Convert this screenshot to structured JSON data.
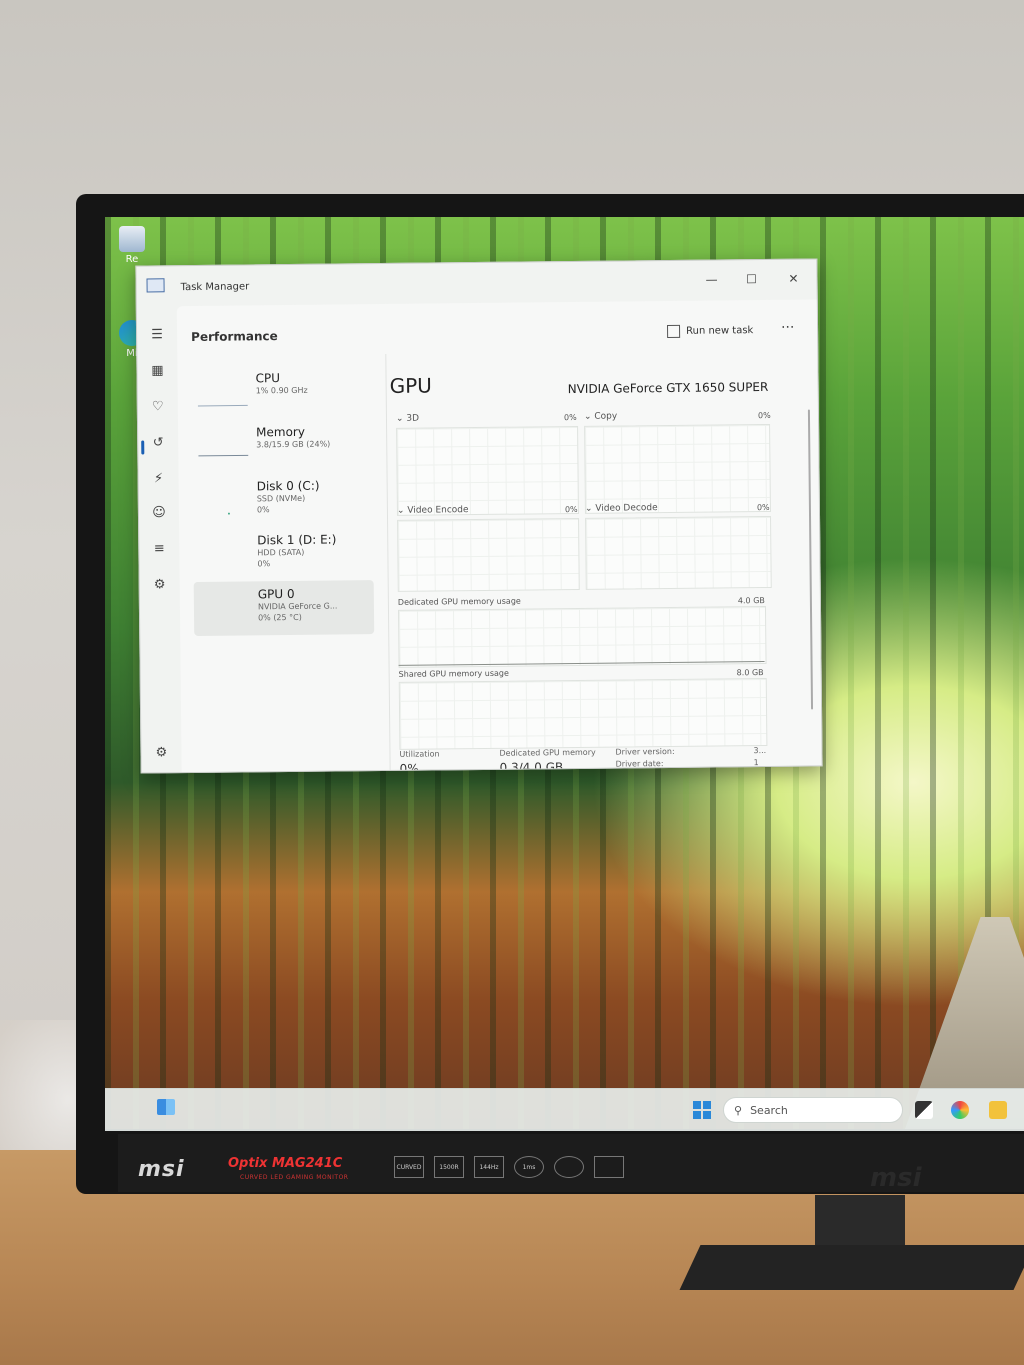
{
  "desktop": {
    "icons": [
      {
        "label": "Re",
        "icon": "recycle-bin-icon"
      },
      {
        "label": "Mi",
        "icon": "edge-icon"
      }
    ]
  },
  "monitor": {
    "brand": "msi",
    "model": "Optix MAG241C",
    "model_sub": "CURVED LED GAMING MONITOR",
    "features": [
      "CURVED",
      "1500R",
      "144Hz",
      "1ms",
      "",
      ""
    ],
    "brand_right": "msi"
  },
  "task_manager": {
    "window_title": "Task Manager",
    "page_title": "Performance",
    "run_new_task": "Run new task",
    "more_label": "···",
    "window_controls": {
      "minimize": "—",
      "maximize": "☐",
      "close": "✕"
    },
    "nav_icons": [
      "hamburger-icon",
      "processes-icon",
      "performance-icon",
      "app-history-icon",
      "startup-apps-icon",
      "users-icon",
      "details-icon",
      "services-icon",
      "settings-icon"
    ],
    "resources": [
      {
        "name": "CPU",
        "line1": "1% 0.90 GHz",
        "line2": ""
      },
      {
        "name": "Memory",
        "line1": "3.8/15.9 GB (24%)",
        "line2": ""
      },
      {
        "name": "Disk 0 (C:)",
        "line1": "SSD (NVMe)",
        "line2": "0%"
      },
      {
        "name": "Disk 1 (D: E:)",
        "line1": "HDD (SATA)",
        "line2": "0%"
      },
      {
        "name": "GPU 0",
        "line1": "NVIDIA GeForce G...",
        "line2": "0% (25 °C)"
      }
    ],
    "selected_resource": "GPU 0",
    "detail": {
      "heading": "GPU",
      "model": "NVIDIA GeForce GTX 1650 SUPER",
      "engines": [
        {
          "label": "3D",
          "pct": "0%"
        },
        {
          "label": "Copy",
          "pct": "0%"
        },
        {
          "label": "Video Encode",
          "pct": "0%"
        },
        {
          "label": "Video Decode",
          "pct": "0%"
        }
      ],
      "dedicated_label": "Dedicated GPU memory usage",
      "dedicated_max": "4.0 GB",
      "shared_label": "Shared GPU memory usage",
      "shared_max": "8.0 GB",
      "stats": [
        {
          "label": "Utilization",
          "value": "0%"
        },
        {
          "label": "Dedicated GPU memory",
          "value": "0.3/4.0 GB"
        },
        {
          "label": "Driver version:",
          "value": "3..."
        },
        {
          "label": "Driver date:",
          "value": "1"
        }
      ]
    }
  },
  "taskbar": {
    "search_placeholder": "Search"
  }
}
